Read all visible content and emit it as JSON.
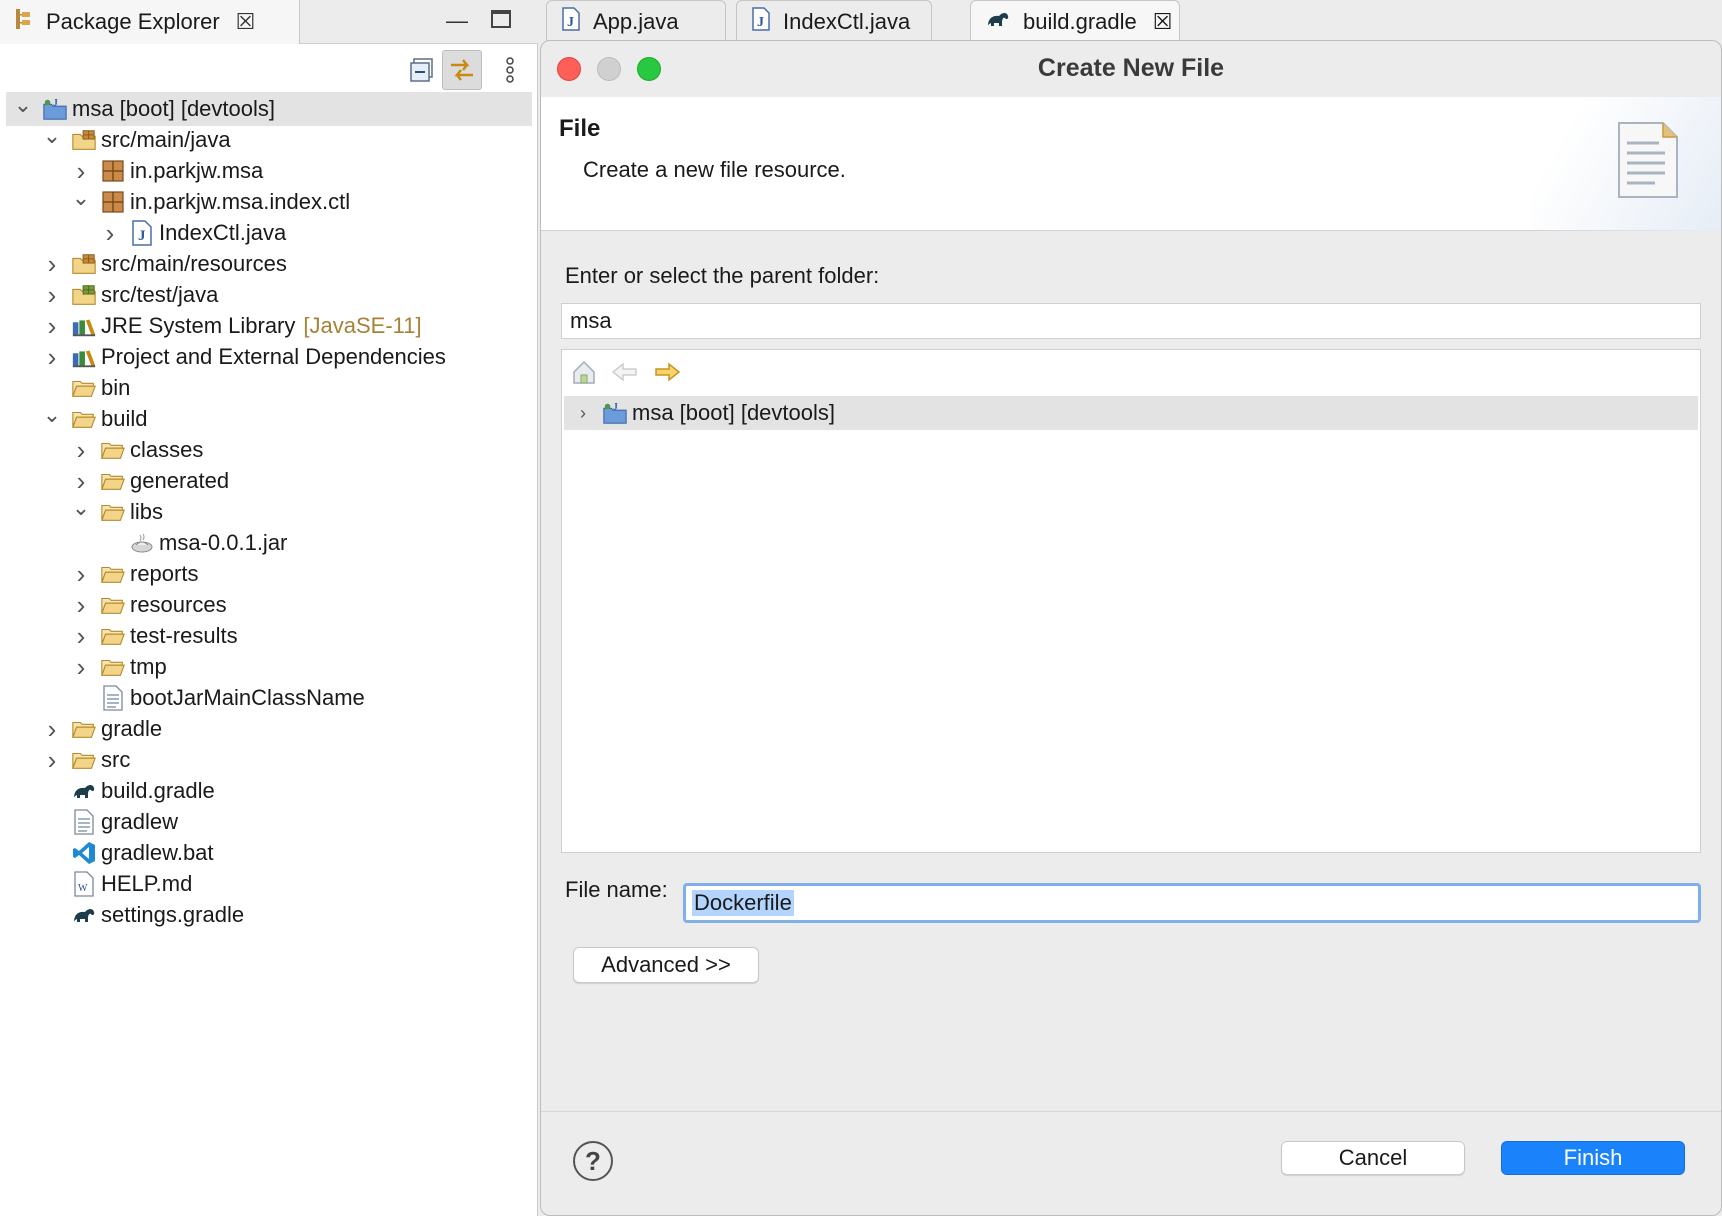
{
  "package_explorer": {
    "tab_title": "Package Explorer",
    "icons": {
      "minimize": "minimize-icon",
      "maximize": "maximize-icon",
      "collapse_all": "collapse-all-icon",
      "link_editor": "link-with-editor-icon",
      "view_menu": "view-menu-icon"
    },
    "tree": [
      {
        "label": "msa [boot] [devtools]",
        "chevron": "down",
        "icon": "project",
        "level": 0,
        "selected": true
      },
      {
        "label": "src/main/java",
        "chevron": "down",
        "icon": "source-folder",
        "level": 1
      },
      {
        "label": "in.parkjw.msa",
        "chevron": "right",
        "icon": "package",
        "level": 2
      },
      {
        "label": "in.parkjw.msa.index.ctl",
        "chevron": "down",
        "icon": "package",
        "level": 2
      },
      {
        "label": "IndexCtl.java",
        "chevron": "right",
        "icon": "java-file",
        "level": 3
      },
      {
        "label": "src/main/resources",
        "chevron": "right",
        "icon": "source-folder",
        "level": 1
      },
      {
        "label": "src/test/java",
        "chevron": "right",
        "icon": "test-source-folder",
        "level": 1
      },
      {
        "label": "JRE System Library",
        "decoration": "[JavaSE-11]",
        "chevron": "right",
        "icon": "library",
        "level": 1
      },
      {
        "label": "Project and External Dependencies",
        "chevron": "right",
        "icon": "library",
        "level": 1
      },
      {
        "label": "bin",
        "chevron": "none",
        "icon": "folder",
        "level": 1
      },
      {
        "label": "build",
        "chevron": "down",
        "icon": "folder",
        "level": 1
      },
      {
        "label": "classes",
        "chevron": "right",
        "icon": "folder",
        "level": 2
      },
      {
        "label": "generated",
        "chevron": "right",
        "icon": "folder",
        "level": 2
      },
      {
        "label": "libs",
        "chevron": "down",
        "icon": "folder",
        "level": 2
      },
      {
        "label": "msa-0.0.1.jar",
        "chevron": "none",
        "icon": "jar",
        "level": 3
      },
      {
        "label": "reports",
        "chevron": "right",
        "icon": "folder",
        "level": 2
      },
      {
        "label": "resources",
        "chevron": "right",
        "icon": "folder",
        "level": 2
      },
      {
        "label": "test-results",
        "chevron": "right",
        "icon": "folder",
        "level": 2
      },
      {
        "label": "tmp",
        "chevron": "right",
        "icon": "folder",
        "level": 2
      },
      {
        "label": "bootJarMainClassName",
        "chevron": "none",
        "icon": "text-file",
        "level": 2
      },
      {
        "label": "gradle",
        "chevron": "right",
        "icon": "folder",
        "level": 1
      },
      {
        "label": "src",
        "chevron": "right",
        "icon": "folder",
        "level": 1
      },
      {
        "label": "build.gradle",
        "chevron": "none",
        "icon": "gradle",
        "level": 1
      },
      {
        "label": "gradlew",
        "chevron": "none",
        "icon": "text-file",
        "level": 1
      },
      {
        "label": "gradlew.bat",
        "chevron": "none",
        "icon": "vscode",
        "level": 1
      },
      {
        "label": "HELP.md",
        "chevron": "none",
        "icon": "markdown",
        "level": 1
      },
      {
        "label": "settings.gradle",
        "chevron": "none",
        "icon": "gradle",
        "level": 1
      }
    ]
  },
  "editor_tabs": [
    {
      "label": "App.java",
      "icon": "java-file-icon"
    },
    {
      "label": "IndexCtl.java",
      "icon": "java-file-icon"
    },
    {
      "label": "build.gradle",
      "icon": "gradle-icon",
      "active": true,
      "close": "close-icon"
    }
  ],
  "dialog": {
    "title": "Create New File",
    "banner_title": "File",
    "banner_description": "Create a new file resource.",
    "parent_folder_label": "Enter or select the parent folder:",
    "parent_folder_value": "msa",
    "folder_tree_item": "msa [boot] [devtools]",
    "file_name_label": "File name:",
    "file_name_value": "Dockerfile",
    "advanced_button": "Advanced >>",
    "cancel_button": "Cancel",
    "finish_button": "Finish",
    "help": "?"
  },
  "colors": {
    "close_light": "#fe5f57",
    "minimize_light": "#d0d0d0",
    "zoom_light": "#28c840",
    "finish_blue": "#1a82fb",
    "decoration_brown": "#a58236",
    "focus_ring": "#7fb0ec"
  }
}
